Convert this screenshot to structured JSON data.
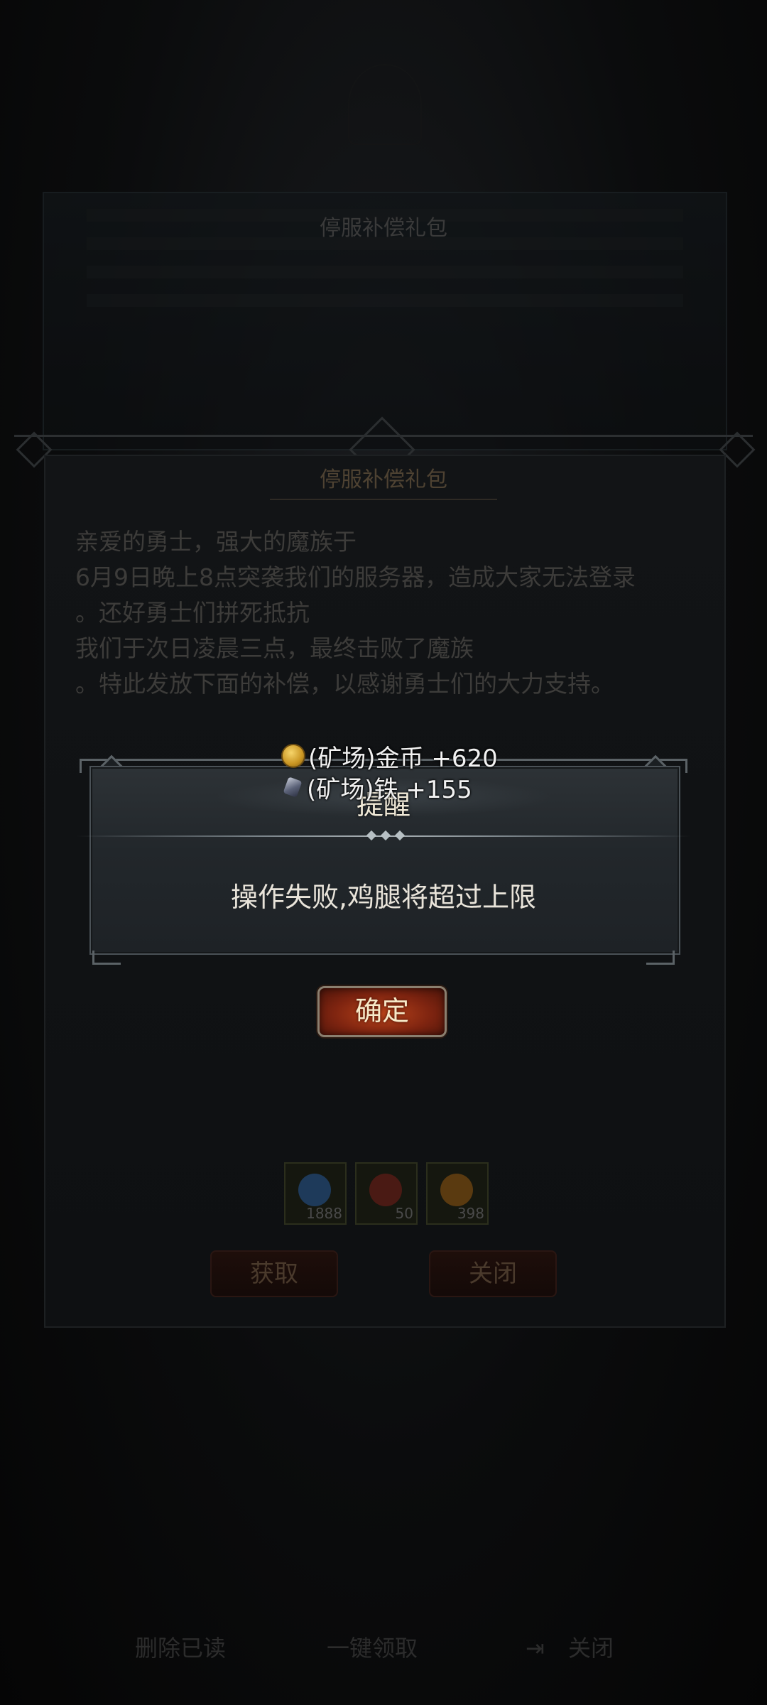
{
  "background_panel": {
    "title": "停服补偿礼包"
  },
  "main_dialog": {
    "title": "停服补偿礼包",
    "message_lines": [
      "亲爱的勇士，强大的魔族于",
      "6月9日晚上8点突袭我们的服务器，造成大家无法登录",
      "。还好勇士们拼死抵抗",
      "我们于次日凌晨三点，最终击败了魔族",
      "。特此发放下面的补偿，以感谢勇士们的大力支持。"
    ],
    "items": [
      {
        "icon": "blue-gem-icon",
        "count": "1888",
        "color": "#1e3a5a"
      },
      {
        "icon": "chicken-leg-icon",
        "count": "50",
        "color": "#4a1a14"
      },
      {
        "icon": "orange-crystal-icon",
        "count": "398",
        "color": "#5a3a10"
      }
    ],
    "get_label": "获取",
    "close_label": "关闭"
  },
  "bottom_nav": {
    "left_label": "删除已读",
    "middle_label": "一键领取",
    "right_label": "关闭"
  },
  "rewards": [
    {
      "icon": "gold-coin-icon",
      "text": "(矿场)金币 +620"
    },
    {
      "icon": "iron-ore-icon",
      "text": "(矿场)铁 +155"
    }
  ],
  "alert": {
    "title": "提醒",
    "message": "操作失败,鸡腿将超过上限",
    "confirm_label": "确定"
  }
}
